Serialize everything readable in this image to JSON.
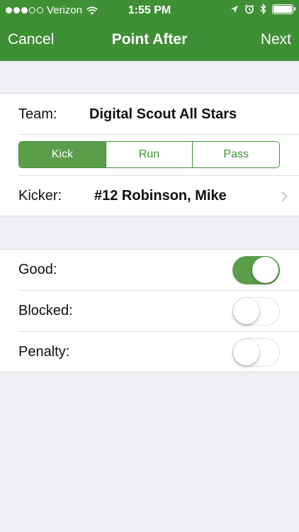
{
  "status_bar": {
    "carrier": "Verizon",
    "time": "1:55 PM",
    "signal_bars_filled": 3,
    "signal_bars_total": 5
  },
  "nav": {
    "cancel_label": "Cancel",
    "title": "Point After",
    "next_label": "Next"
  },
  "team": {
    "label": "Team:",
    "value": "Digital Scout All Stars"
  },
  "play_type": {
    "options": [
      "Kick",
      "Run",
      "Pass"
    ],
    "selected": "Kick"
  },
  "kicker": {
    "label": "Kicker:",
    "value": "#12 Robinson, Mike"
  },
  "toggles": [
    {
      "label": "Good:",
      "on": true
    },
    {
      "label": "Blocked:",
      "on": false
    },
    {
      "label": "Penalty:",
      "on": false
    }
  ],
  "colors": {
    "brand_green": "#3f8f35",
    "switch_on": "#5b9e4a",
    "background": "#efeff4"
  }
}
